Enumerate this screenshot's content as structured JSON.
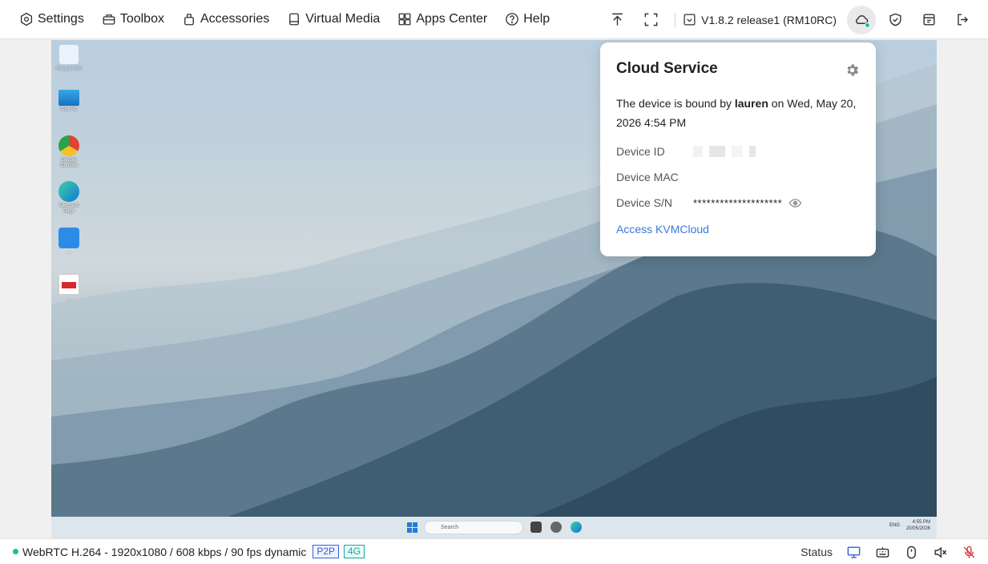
{
  "menu": {
    "settings": "Settings",
    "toolbox": "Toolbox",
    "accessories": "Accessories",
    "virtual_media": "Virtual Media",
    "apps_center": "Apps Center",
    "help": "Help"
  },
  "version": "V1.8.2 release1 (RM10RC)",
  "cloud_popover": {
    "title": "Cloud Service",
    "bound_prefix": "The device is bound by",
    "bound_user": "lauren",
    "bound_suffix": "on Wed, May 20, 2026 4:54 PM",
    "device_id_label": "Device ID",
    "device_mac_label": "Device MAC",
    "device_sn_label": "Device S/N",
    "device_sn_value": "********************",
    "access_link": "Access KVMCloud"
  },
  "desktop": {
    "icons": [
      {
        "label": "Recycle Bin"
      },
      {
        "label": "This PC"
      },
      {
        "label": "Google Chrome"
      },
      {
        "label": "Microsoft Edge"
      },
      {
        "label": "…"
      },
      {
        "label": "…"
      }
    ],
    "taskbar_search": "Search",
    "tray_lang": "ENG",
    "clock_time": "4:55 PM",
    "clock_date": "20/05/2026"
  },
  "status": {
    "stream": "WebRTC H.264 - 1920x1080 /  608 kbps / 90 fps dynamic",
    "badge_p2p": "P2P",
    "badge_4g": "4G",
    "label": "Status"
  },
  "colors": {
    "accent_green": "#1bbf9a",
    "link_blue": "#3a77e0",
    "p2p_blue": "#3a5ed8",
    "badge_teal": "#14a89a"
  }
}
